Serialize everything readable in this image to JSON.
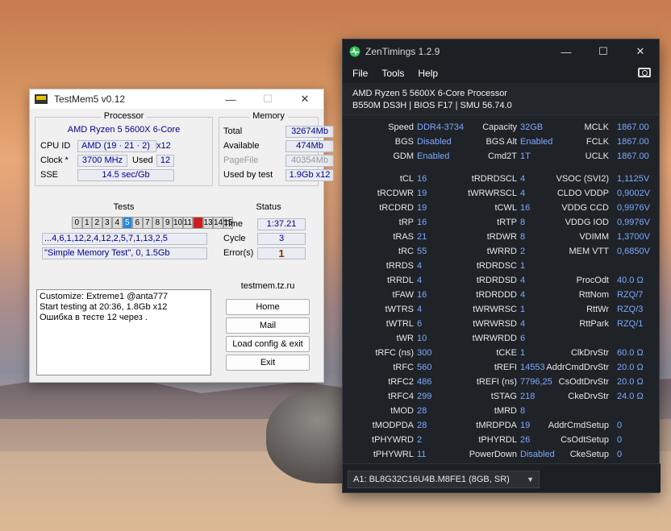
{
  "testmem": {
    "title": "TestMem5 v0.12",
    "processor": {
      "group_title": "Processor",
      "name": "AMD Ryzen 5 5600X 6-Core",
      "cpu_id_label": "CPU ID",
      "cpu_id_value": "AMD  (19 · 21 · 2)",
      "cpu_id_count": "x12",
      "clock_label": "Clock *",
      "clock_value": "3700 MHz",
      "used_label": "Used",
      "used_value": "12",
      "sse_label": "SSE",
      "sse_value": "14.5 sec/Gb"
    },
    "memory": {
      "group_title": "Memory",
      "total_label": "Total",
      "total_value": "32674Mb",
      "available_label": "Available",
      "available_value": "474Mb",
      "pagefile_label": "PageFile",
      "pagefile_value": "40354Mb",
      "usedbytest_label": "Used by test",
      "usedbytest_value": "1.9Gb x12"
    },
    "tests": {
      "group_title": "Tests",
      "cells": [
        "0",
        "1",
        "2",
        "3",
        "4",
        "5",
        "6",
        "7",
        "8",
        "9",
        "10",
        "11",
        "12",
        "13",
        "14",
        "15"
      ],
      "current_index": 5,
      "error_index": 12,
      "sequence": "...4,6,1,12,2,4,12,2,5,7,1,13,2,5",
      "description": "\"Simple Memory Test\", 0, 1.5Gb"
    },
    "status": {
      "group_title": "Status",
      "time_label": "Time",
      "time_value": "1:37.21",
      "cycle_label": "Cycle",
      "cycle_value": "3",
      "errors_label": "Error(s)",
      "errors_value": "1"
    },
    "log": {
      "line1": "Customize: Extreme1 @anta777",
      "line2": "Start testing at 20:36, 1.8Gb x12",
      "line3": "Ошибка в тесте 12 через ."
    },
    "site": {
      "group_title": "testmem.tz.ru",
      "home": "Home",
      "mail": "Mail",
      "load": "Load config & exit",
      "exit": "Exit"
    }
  },
  "zen": {
    "title": "ZenTimings 1.2.9",
    "menu": {
      "file": "File",
      "tools": "Tools",
      "help": "Help"
    },
    "cpu": "AMD Ryzen 5 5600X 6-Core Processor",
    "board": "B550M DS3H | BIOS F17 | SMU 56.74.0",
    "top": [
      {
        "c1l": "Speed",
        "c1v": "DDR4-3734",
        "c2l": "Capacity",
        "c2v": "32GB",
        "c3l": "MCLK",
        "c3v": "1867.00"
      },
      {
        "c1l": "BGS",
        "c1v": "Disabled",
        "c2l": "BGS Alt",
        "c2v": "Enabled",
        "c3l": "FCLK",
        "c3v": "1867.00"
      },
      {
        "c1l": "GDM",
        "c1v": "Enabled",
        "c2l": "Cmd2T",
        "c2v": "1T",
        "c3l": "UCLK",
        "c3v": "1867.00"
      }
    ],
    "timings": [
      {
        "c1l": "tCL",
        "c1v": "16",
        "c2l": "tRDRDSCL",
        "c2v": "4",
        "c3l": "VSOC (SVI2)",
        "c3v": "1,1125V"
      },
      {
        "c1l": "tRCDWR",
        "c1v": "19",
        "c2l": "tWRWRSCL",
        "c2v": "4",
        "c3l": "CLDO VDDP",
        "c3v": "0,9002V"
      },
      {
        "c1l": "tRCDRD",
        "c1v": "19",
        "c2l": "tCWL",
        "c2v": "16",
        "c3l": "VDDG CCD",
        "c3v": "0,9976V"
      },
      {
        "c1l": "tRP",
        "c1v": "16",
        "c2l": "tRTP",
        "c2v": "8",
        "c3l": "VDDG IOD",
        "c3v": "0,9976V"
      },
      {
        "c1l": "tRAS",
        "c1v": "21",
        "c2l": "tRDWR",
        "c2v": "8",
        "c3l": "VDIMM",
        "c3v": "1,3700V"
      },
      {
        "c1l": "tRC",
        "c1v": "55",
        "c2l": "tWRRD",
        "c2v": "2",
        "c3l": "MEM VTT",
        "c3v": "0,6850V"
      },
      {
        "c1l": "tRRDS",
        "c1v": "4",
        "c2l": "tRDRDSC",
        "c2v": "1",
        "c3l": "",
        "c3v": ""
      },
      {
        "c1l": "tRRDL",
        "c1v": "4",
        "c2l": "tRDRDSD",
        "c2v": "4",
        "c3l": "ProcOdt",
        "c3v": "40.0 Ω"
      },
      {
        "c1l": "tFAW",
        "c1v": "16",
        "c2l": "tRDRDDD",
        "c2v": "4",
        "c3l": "RttNom",
        "c3v": "RZQ/7"
      },
      {
        "c1l": "tWTRS",
        "c1v": "4",
        "c2l": "tWRWRSC",
        "c2v": "1",
        "c3l": "RttWr",
        "c3v": "RZQ/3"
      },
      {
        "c1l": "tWTRL",
        "c1v": "6",
        "c2l": "tWRWRSD",
        "c2v": "4",
        "c3l": "RttPark",
        "c3v": "RZQ/1"
      },
      {
        "c1l": "tWR",
        "c1v": "10",
        "c2l": "tWRWRDD",
        "c2v": "6",
        "c3l": "",
        "c3v": ""
      },
      {
        "c1l": "tRFC (ns)",
        "c1v": "300",
        "c2l": "tCKE",
        "c2v": "1",
        "c3l": "ClkDrvStr",
        "c3v": "60.0 Ω"
      },
      {
        "c1l": "tRFC",
        "c1v": "560",
        "c2l": "tREFI",
        "c2v": "14553",
        "c3l": "AddrCmdDrvStr",
        "c3v": "20.0 Ω"
      },
      {
        "c1l": "tRFC2",
        "c1v": "486",
        "c2l": "tREFI (ns)",
        "c2v": "7796,25",
        "c3l": "CsOdtDrvStr",
        "c3v": "20.0 Ω"
      },
      {
        "c1l": "tRFC4",
        "c1v": "299",
        "c2l": "tSTAG",
        "c2v": "218",
        "c3l": "CkeDrvStr",
        "c3v": "24.0 Ω"
      },
      {
        "c1l": "tMOD",
        "c1v": "28",
        "c2l": "tMRD",
        "c2v": "8",
        "c3l": "",
        "c3v": ""
      },
      {
        "c1l": "tMODPDA",
        "c1v": "28",
        "c2l": "tMRDPDA",
        "c2v": "19",
        "c3l": "AddrCmdSetup",
        "c3v": "0"
      },
      {
        "c1l": "tPHYWRD",
        "c1v": "2",
        "c2l": "tPHYRDL",
        "c2v": "26",
        "c3l": "CsOdtSetup",
        "c3v": "0"
      },
      {
        "c1l": "tPHYWRL",
        "c1v": "11",
        "c2l": "PowerDown",
        "c2v": "Disabled",
        "c3l": "CkeSetup",
        "c3v": "0"
      }
    ],
    "dimm": "A1: BL8G32C16U4B.M8FE1 (8GB, SR)"
  },
  "colors": {
    "accent_value": "#7fa8ff",
    "test_current": "#1e8ae0",
    "test_error": "#d01c1c",
    "tm_text_blue": "#00008b"
  }
}
